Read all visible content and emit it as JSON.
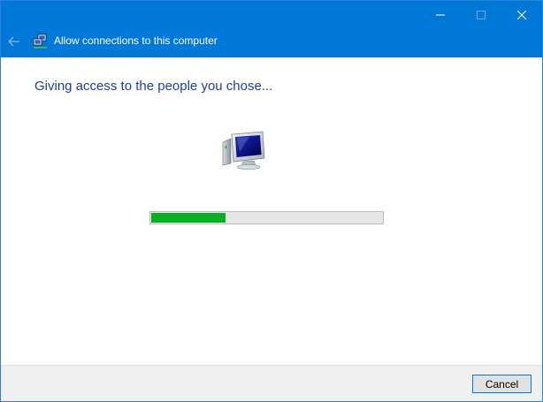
{
  "window": {
    "title": "Allow connections to this computer"
  },
  "main": {
    "heading": "Giving access to the people you chose...",
    "progress": 0.32
  },
  "footer": {
    "cancel_label": "Cancel"
  },
  "colors": {
    "titlebar": "#0078d7",
    "heading": "#1f3d93",
    "progress_fill": "#06b025"
  },
  "icons": {
    "title": "network-computer-icon",
    "main": "computer-monitor-icon"
  }
}
